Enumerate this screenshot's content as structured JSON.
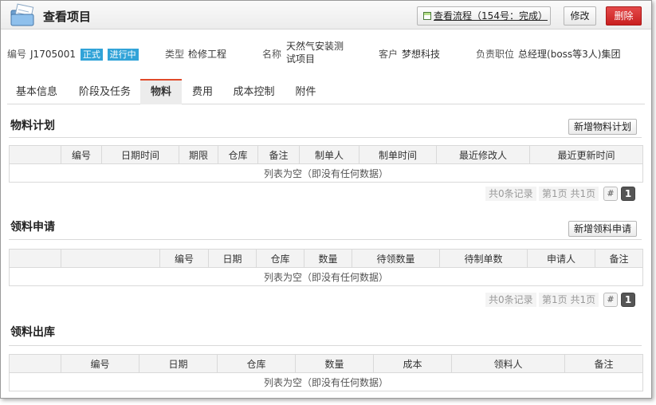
{
  "header": {
    "title": "查看项目",
    "flow_button": "查看流程（154号：完成）",
    "edit_button": "修改",
    "delete_button": "删除"
  },
  "info": {
    "code_label": "编号",
    "code_value": "J1705001",
    "badge_formal": "正式",
    "badge_status": "进行中",
    "type_label": "类型",
    "type_value": "检修工程",
    "name_label": "名称",
    "name_value": "天然气安装测试项目",
    "client_label": "客户",
    "client_value": "梦想科技",
    "position_label": "负责职位",
    "position_value": "总经理(boss等3人)集团"
  },
  "tabs": [
    "基本信息",
    "阶段及任务",
    "物料",
    "费用",
    "成本控制",
    "附件"
  ],
  "active_tab": "物料",
  "sections": {
    "plan": {
      "title": "物料计划",
      "add_button": "新增物料计划",
      "columns": [
        "",
        "编号",
        "日期时间",
        "期限",
        "仓库",
        "备注",
        "制单人",
        "制单时间",
        "最近修改人",
        "最近更新时间"
      ],
      "empty_text": "列表为空（即没有任何数据）",
      "total": "共0条记录",
      "pages": "第1页 共1页",
      "hash": "#",
      "page_num": "1"
    },
    "apply": {
      "title": "领料申请",
      "add_button": "新增领料申请",
      "columns": [
        "",
        "",
        "编号",
        "日期",
        "仓库",
        "数量",
        "待领数量",
        "待制单数",
        "申请人",
        "备注"
      ],
      "empty_text": "列表为空（即没有任何数据）",
      "total": "共0条记录",
      "pages": "第1页 共1页",
      "hash": "#",
      "page_num": "1"
    },
    "out": {
      "title": "领料出库",
      "columns": [
        "",
        "编号",
        "日期",
        "仓库",
        "数量",
        "成本",
        "领料人",
        "备注"
      ],
      "empty_text": "列表为空（即没有任何数据）"
    }
  },
  "colors": {
    "badge": "#31a3d8",
    "delete_button": "#d22a2a",
    "active_tab_accent": "#e04a2a"
  }
}
